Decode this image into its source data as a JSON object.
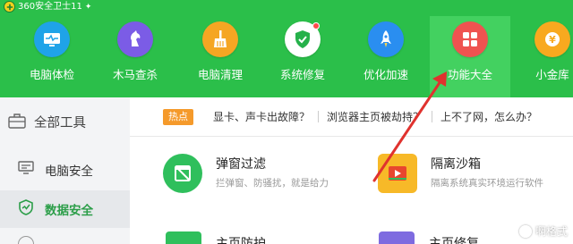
{
  "app": {
    "title": "360安全卫士11",
    "upgrade_icon": "up-arrow-icon"
  },
  "nav": {
    "items": [
      {
        "label": "电脑体检",
        "icon": "monitor-check-icon",
        "color": "#1fa3e8"
      },
      {
        "label": "木马查杀",
        "icon": "horse-icon",
        "color": "#7b5ce6"
      },
      {
        "label": "电脑清理",
        "icon": "broom-icon",
        "color": "#f5a623"
      },
      {
        "label": "系统修复",
        "icon": "shield-repair-icon",
        "color": "#25b14a"
      },
      {
        "label": "优化加速",
        "icon": "rocket-icon",
        "color": "#2a8ef0"
      },
      {
        "label": "功能大全",
        "icon": "grid-apps-icon",
        "color": "#ef5350"
      },
      {
        "label": "小金库",
        "icon": "coin-icon",
        "color": "#f8a91f"
      }
    ],
    "active_index": 5
  },
  "sidebar": {
    "header": "全部工具",
    "items": [
      {
        "label": "电脑安全",
        "icon": "computer-icon"
      },
      {
        "label": "数据安全",
        "icon": "shield-data-icon"
      }
    ],
    "active_index": 1
  },
  "hotbar": {
    "badge": "热点",
    "links": [
      "显卡、声卡出故障？",
      "浏览器主页被劫持？",
      "上不了网，怎么办？"
    ]
  },
  "tools": [
    {
      "name": "弹窗过滤",
      "desc": "拦弹窗、防骚扰，就是给力",
      "icon": "popup-filter-icon"
    },
    {
      "name": "隔离沙箱",
      "desc": "隔离系统真实环境运行软件",
      "icon": "sandbox-icon"
    },
    {
      "name": "主页防护",
      "icon": "homepage-guard-icon"
    },
    {
      "name": "主页修复",
      "icon": "homepage-repair-icon"
    }
  ],
  "watermark": {
    "text": "啊格式"
  },
  "colors": {
    "header_green": "#2bbf4a",
    "active_tab": "#43d160",
    "hot_badge": "#f59a2b",
    "annotation_arrow": "#e0322e"
  }
}
